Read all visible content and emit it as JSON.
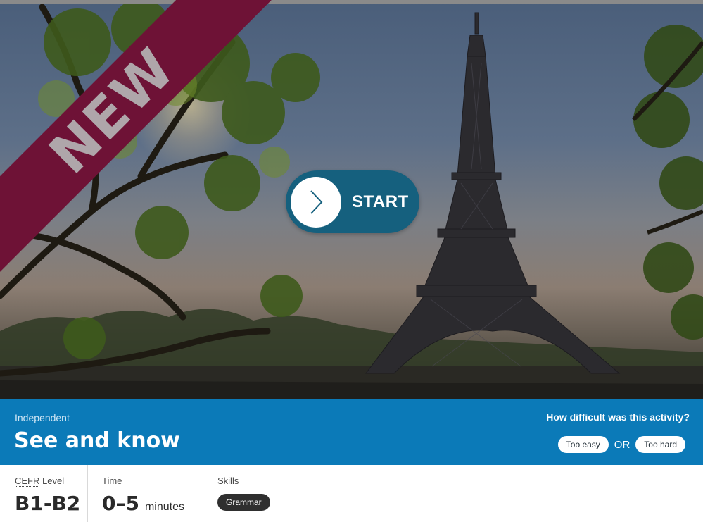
{
  "ribbon": {
    "text": "NEW"
  },
  "hero": {
    "start_label": "START",
    "start_icon": "chevron-right-icon"
  },
  "activity": {
    "level_band": "Independent",
    "title": "See and know",
    "feedback_question": "How difficult was this activity?",
    "too_easy": "Too easy",
    "or": "OR",
    "too_hard": "Too hard"
  },
  "details": {
    "cefr_abbr": "CEFR",
    "cefr_label_rest": " Level",
    "cefr_value": "B1-B2",
    "time_label": "Time",
    "time_value": "0–5",
    "time_unit": "minutes",
    "skills_label": "Skills",
    "skills": [
      "Grammar"
    ]
  },
  "colors": {
    "ribbon": "#6e1236",
    "start_button": "#15607e",
    "band": "#0b7ab8",
    "skill_chip": "#2f2f2f"
  }
}
